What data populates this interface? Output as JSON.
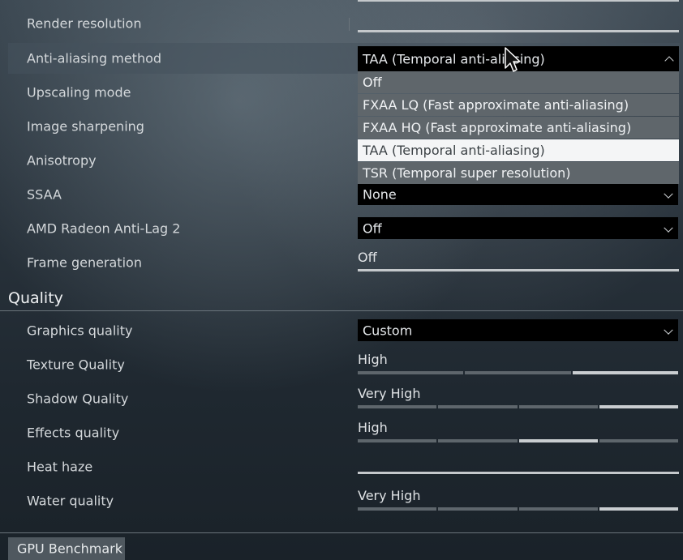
{
  "settings_top": [
    {
      "name": "render-resolution",
      "label": "Render resolution"
    },
    {
      "name": "anti-aliasing-method",
      "label": "Anti-aliasing method",
      "value": "TAA (Temporal anti-aliasing)"
    },
    {
      "name": "upscaling-mode",
      "label": "Upscaling mode"
    },
    {
      "name": "image-sharpening",
      "label": "Image sharpening"
    },
    {
      "name": "anisotropy",
      "label": "Anisotropy"
    },
    {
      "name": "ssaa",
      "label": "SSAA",
      "value": "None"
    },
    {
      "name": "amd-anti-lag",
      "label": "AMD Radeon Anti-Lag 2",
      "value": "Off"
    },
    {
      "name": "frame-generation",
      "label": "Frame generation",
      "value": "Off"
    }
  ],
  "aa_options": [
    "Off",
    "FXAA LQ (Fast approximate anti-aliasing)",
    "FXAA HQ (Fast approximate anti-aliasing)",
    "TAA (Temporal anti-aliasing)",
    "TSR (Temporal super resolution)"
  ],
  "aa_selected_index": 3,
  "quality": {
    "title": "Quality",
    "graphics_quality": {
      "label": "Graphics quality",
      "value": "Custom"
    },
    "texture_quality": {
      "label": "Texture Quality",
      "value": "High",
      "level": 3,
      "of": 3
    },
    "shadow_quality": {
      "label": "Shadow Quality",
      "value": "Very High",
      "level": 4,
      "of": 4
    },
    "effects_quality": {
      "label": "Effects quality",
      "value": "High",
      "level": 3,
      "of": 4
    },
    "heat_haze": {
      "label": "Heat haze"
    },
    "water_quality": {
      "label": "Water quality",
      "value": "Very High",
      "level": 4,
      "of": 4
    }
  },
  "footer": {
    "benchmark_label": "GPU Benchmark"
  },
  "colors": {
    "dropdown_bg": "#000000",
    "option_bg": "#5f666b",
    "option_selected_bg": "#f4f5f6",
    "track_on": "#c9cdd0",
    "track_off": "#5e666c"
  }
}
